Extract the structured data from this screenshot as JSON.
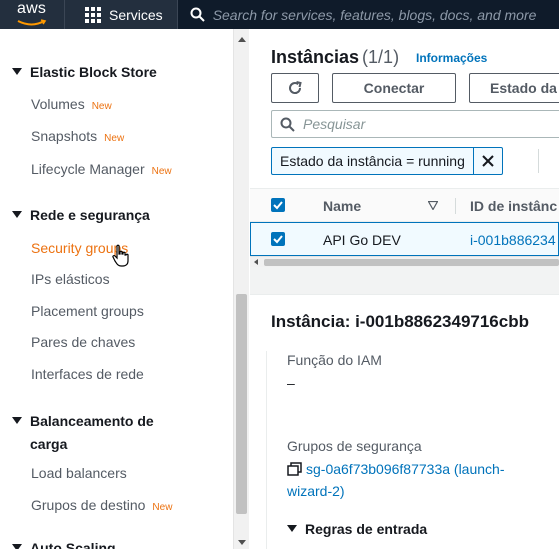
{
  "topbar": {
    "logo": "aws",
    "services_label": "Services",
    "search_placeholder": "Search for services, features, blogs, docs, and more",
    "icons": [
      "grid-icon",
      "search-icon"
    ]
  },
  "sidebar": {
    "sections": [
      {
        "label": "Elastic Block Store"
      },
      {
        "label": "Rede e segurança"
      },
      {
        "label": "Balanceamento de",
        "label2": "carga"
      },
      {
        "label": "Auto Scaling"
      }
    ],
    "items": [
      {
        "label": "Volumes",
        "badge": "New"
      },
      {
        "label": "Snapshots",
        "badge": "New"
      },
      {
        "label": "Lifecycle Manager",
        "badge": "New"
      },
      {
        "label": "Security groups",
        "badge": ""
      },
      {
        "label": "IPs elásticos",
        "badge": ""
      },
      {
        "label": "Placement groups",
        "badge": ""
      },
      {
        "label": "Pares de chaves",
        "badge": ""
      },
      {
        "label": "Interfaces de rede",
        "badge": ""
      },
      {
        "label": "Load balancers",
        "badge": ""
      },
      {
        "label": "Grupos de destino",
        "badge": "New"
      }
    ],
    "active_item": "Security groups"
  },
  "instances": {
    "title": "Instâncias",
    "count": "(1/1)",
    "info_link": "Informações",
    "refresh_icon": "refresh-icon",
    "connect_label": "Conectar",
    "state_label": "Estado da in",
    "search_placeholder": "Pesquisar",
    "filter_token": "Estado da instância = running",
    "table": {
      "headers": [
        "Name",
        "ID de instânc"
      ],
      "rows": [
        {
          "name": "API Go DEV",
          "id": "i-001b886234",
          "selected": true
        }
      ]
    }
  },
  "detail": {
    "title": "Instância: i-001b8862349716cbb",
    "iam_label": "Função do IAM",
    "iam_value": "–",
    "sg_label": "Grupos de segurança",
    "sg_link": "sg-0a6f73b096f87733a (launch-wizard-2)",
    "rules_label": "Regras de entrada"
  },
  "colors": {
    "topbar_bg": "#232f3e",
    "accent_orange": "#ec7211",
    "link_blue": "#0073bb"
  }
}
